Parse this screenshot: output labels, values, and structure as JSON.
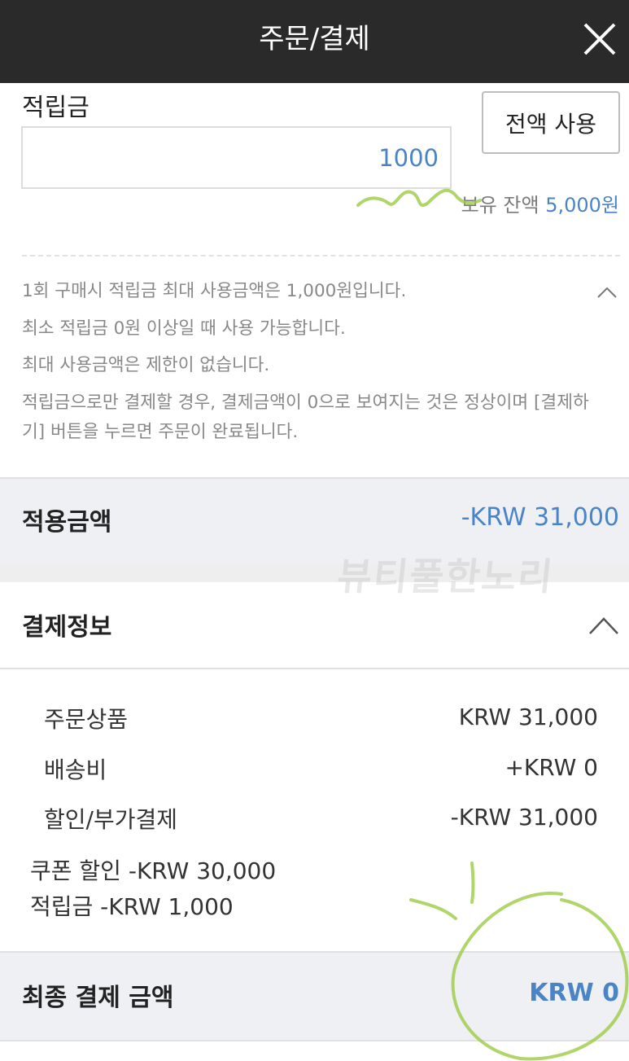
{
  "header": {
    "title": "주문/결제"
  },
  "points": {
    "label": "적립금",
    "input_value": "1000",
    "use_all_label": "전액 사용",
    "balance_label": "보유 잔액",
    "balance_amount": "5,000원"
  },
  "notice": {
    "lines": [
      "1회 구매시 적립금 최대 사용금액은 1,000원입니다.",
      "최소 적립금 0원 이상일 때 사용 가능합니다.",
      "최대 사용금액은 제한이 없습니다.",
      "적립금으로만 결제할 경우, 결제금액이 0으로 보여지는 것은 정상이며 [결제하",
      "기] 버튼을 누르면 주문이 완료됩니다."
    ]
  },
  "applied": {
    "label": "적용금액",
    "value": "-KRW 31,000"
  },
  "watermark": "뷰티풀한노리",
  "payment_info": {
    "title": "결제정보",
    "rows": [
      {
        "label": "주문상품",
        "value": "KRW 31,000"
      },
      {
        "label": "배송비",
        "value": "+KRW 0"
      },
      {
        "label": "할인/부가결제",
        "value": "-KRW 31,000"
      }
    ],
    "details": [
      "쿠폰 할인 -KRW 30,000",
      "적립금 -KRW 1,000"
    ]
  },
  "final": {
    "label": "최종 결제 금액",
    "value": "KRW 0"
  },
  "colors": {
    "accent": "#4a84c6",
    "header_bg": "#2a2a2a",
    "scribble": "#9ccc45"
  }
}
